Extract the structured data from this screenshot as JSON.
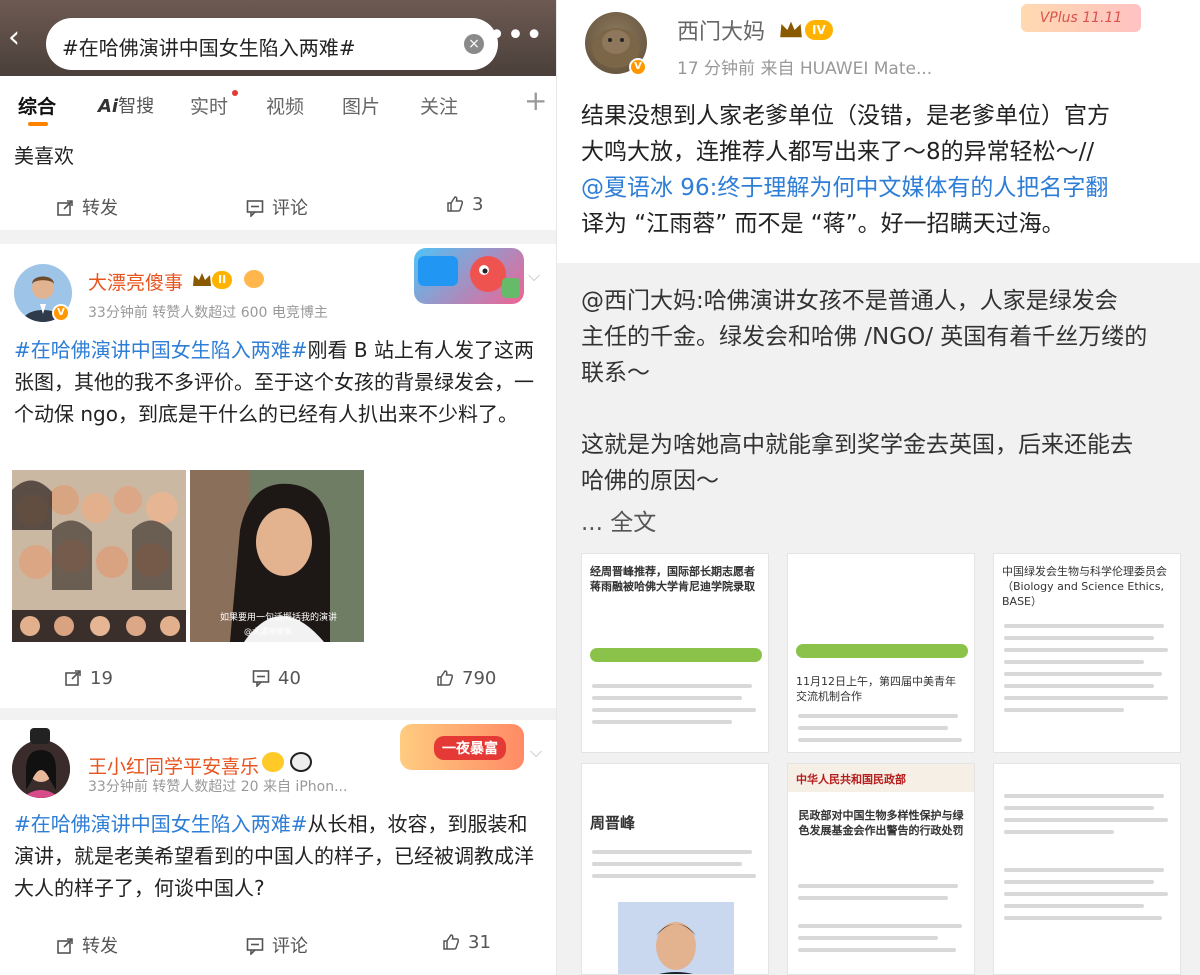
{
  "left": {
    "search": {
      "query": "#在哈佛演讲中国女生陷入两难#",
      "back_icon": "chevron-left-icon",
      "clear_icon": "close-circle-icon",
      "more_icon": "more-dots-icon"
    },
    "tabs": [
      {
        "label": "综合",
        "active": true
      },
      {
        "label": "Ai智搜"
      },
      {
        "label": "实时",
        "dot": true
      },
      {
        "label": "视频"
      },
      {
        "label": "图片"
      },
      {
        "label": "关注"
      }
    ],
    "tabs_plus": "+",
    "card1": {
      "text": "美喜欢",
      "repost_label": "转发",
      "comment_label": "评论",
      "like_count": "3"
    },
    "card2": {
      "username": "大漂亮傻事",
      "level": "II",
      "meta": "33分钟前 转赞人数超过 600  电竞博主",
      "hashtag": "#在哈佛演讲中国女生陷入两难#",
      "text": "刚看 B 站上有人发了这两张图，其他的我不多评价。至于这个女孩的背景绿发会，一个动保 ngo，到底是干什么的已经有人扒出来不少料了。",
      "image2_caption": "如果要用一句话概括我的演讲",
      "image2_watermark": "@大漂亮傻事",
      "repost_count": "19",
      "comment_count": "40",
      "like_count": "790"
    },
    "card3": {
      "username": "王小红同学平安喜乐",
      "meta": "33分钟前 转赞人数超过 20  来自 iPhon...",
      "sticker": "一夜暴富",
      "hashtag": "#在哈佛演讲中国女生陷入两难#",
      "text": "从长相，妆容，到服装和演讲，就是老美希望看到的中国人的样子，已经被调教成洋大人的样子了，何谈中国人?",
      "repost_label": "转发",
      "comment_label": "评论",
      "like_count": "31"
    }
  },
  "right": {
    "username": "西门大妈",
    "level": "IV",
    "meta": "17 分钟前  来自 HUAWEI Mate...",
    "vplus": "VPlus 11.11",
    "post_lines": [
      "结果没想到人家老爹单位（没错，是老爹单位）官方",
      "大鸣大放，连推荐人都写出来了～8的异常轻松～//",
      "@夏语冰 96:终于理解为何中文媒体有的人把名字翻",
      "译为 “江雨蓉” 而不是 “蒋”。好一招瞒天过海。"
    ],
    "repost_lines": [
      "@西门大妈:哈佛演讲女孩不是普通人，人家是绿发会",
      "主任的千金。绿发会和哈佛 /NGO/ 英国有着千丝万缕的",
      "联系～",
      "",
      "这就是为啥她高中就能拿到奖学金去英国，后来还能去",
      "哈佛的原因～",
      "... 全文"
    ],
    "thumbs": [
      {
        "title": "经周晋峰推荐，国际部长期志愿者蒋雨融被哈佛大学肯尼迪学院录取"
      },
      {
        "title": "11月12日上午，第四届中美青年交流机制合作"
      },
      {
        "title": "中国绿发会生物与科学伦理委员会（Biology and Science Ethics, BASE）"
      },
      {
        "title": "周晋峰"
      },
      {
        "title": "中华人民共和国民政部"
      },
      {
        "title": "民政部对中国生物多样性保护与绿色发展基金会作出警告的行政处罚"
      }
    ]
  }
}
